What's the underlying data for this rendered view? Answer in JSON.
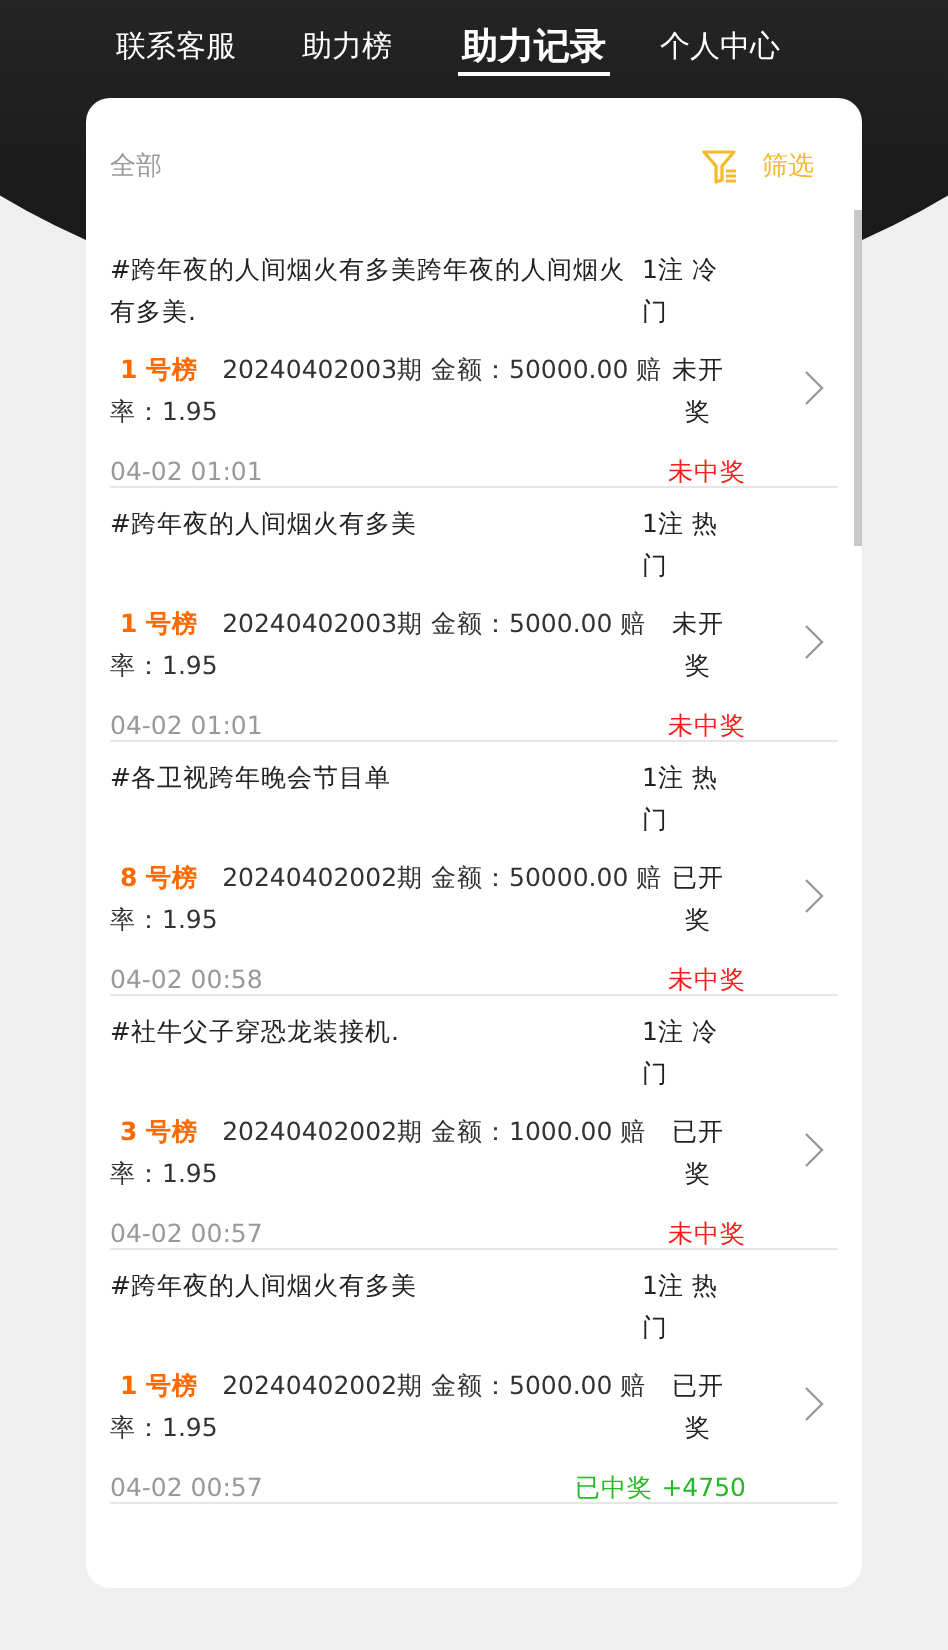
{
  "tabs": [
    {
      "label": "联系客服",
      "selected": false
    },
    {
      "label": "助力榜",
      "selected": false
    },
    {
      "label": "助力记录",
      "selected": true
    },
    {
      "label": "个人中心",
      "selected": false
    }
  ],
  "filter": {
    "current": "全部",
    "button": "筛选"
  },
  "records": [
    {
      "title": "#跨年夜的人间烟火有多美跨年夜的人间烟火有多美.",
      "tag": "1注 冷门",
      "rank": "1 号榜",
      "detail": "20240402003期 金额：50000.00 赔率：1.95",
      "status": "未开奖",
      "time": "04-02 01:01",
      "result": {
        "text": "未中奖",
        "kind": "lost"
      }
    },
    {
      "title": "#跨年夜的人间烟火有多美",
      "tag": "1注 热门",
      "rank": "1 号榜",
      "detail": "20240402003期 金额：5000.00 赔率：1.95",
      "status": "未开奖",
      "time": "04-02 01:01",
      "result": {
        "text": "未中奖",
        "kind": "lost"
      }
    },
    {
      "title": "#各卫视跨年晚会节目单",
      "tag": "1注 热门",
      "rank": "8 号榜",
      "detail": "20240402002期 金额：50000.00 赔率：1.95",
      "status": "已开奖",
      "time": "04-02 00:58",
      "result": {
        "text": "未中奖",
        "kind": "lost"
      }
    },
    {
      "title": "#社牛父子穿恐龙装接机.",
      "tag": "1注 冷门",
      "rank": "3 号榜",
      "detail": "20240402002期 金额：1000.00 赔率：1.95",
      "status": "已开奖",
      "time": "04-02 00:57",
      "result": {
        "text": "未中奖",
        "kind": "lost"
      }
    },
    {
      "title": "#跨年夜的人间烟火有多美",
      "tag": "1注 热门",
      "rank": "1 号榜",
      "detail": "20240402002期 金额：5000.00 赔率：1.95",
      "status": "已开奖",
      "time": "04-02 00:57",
      "result": {
        "text": "已中奖 +4750",
        "kind": "won"
      }
    }
  ]
}
